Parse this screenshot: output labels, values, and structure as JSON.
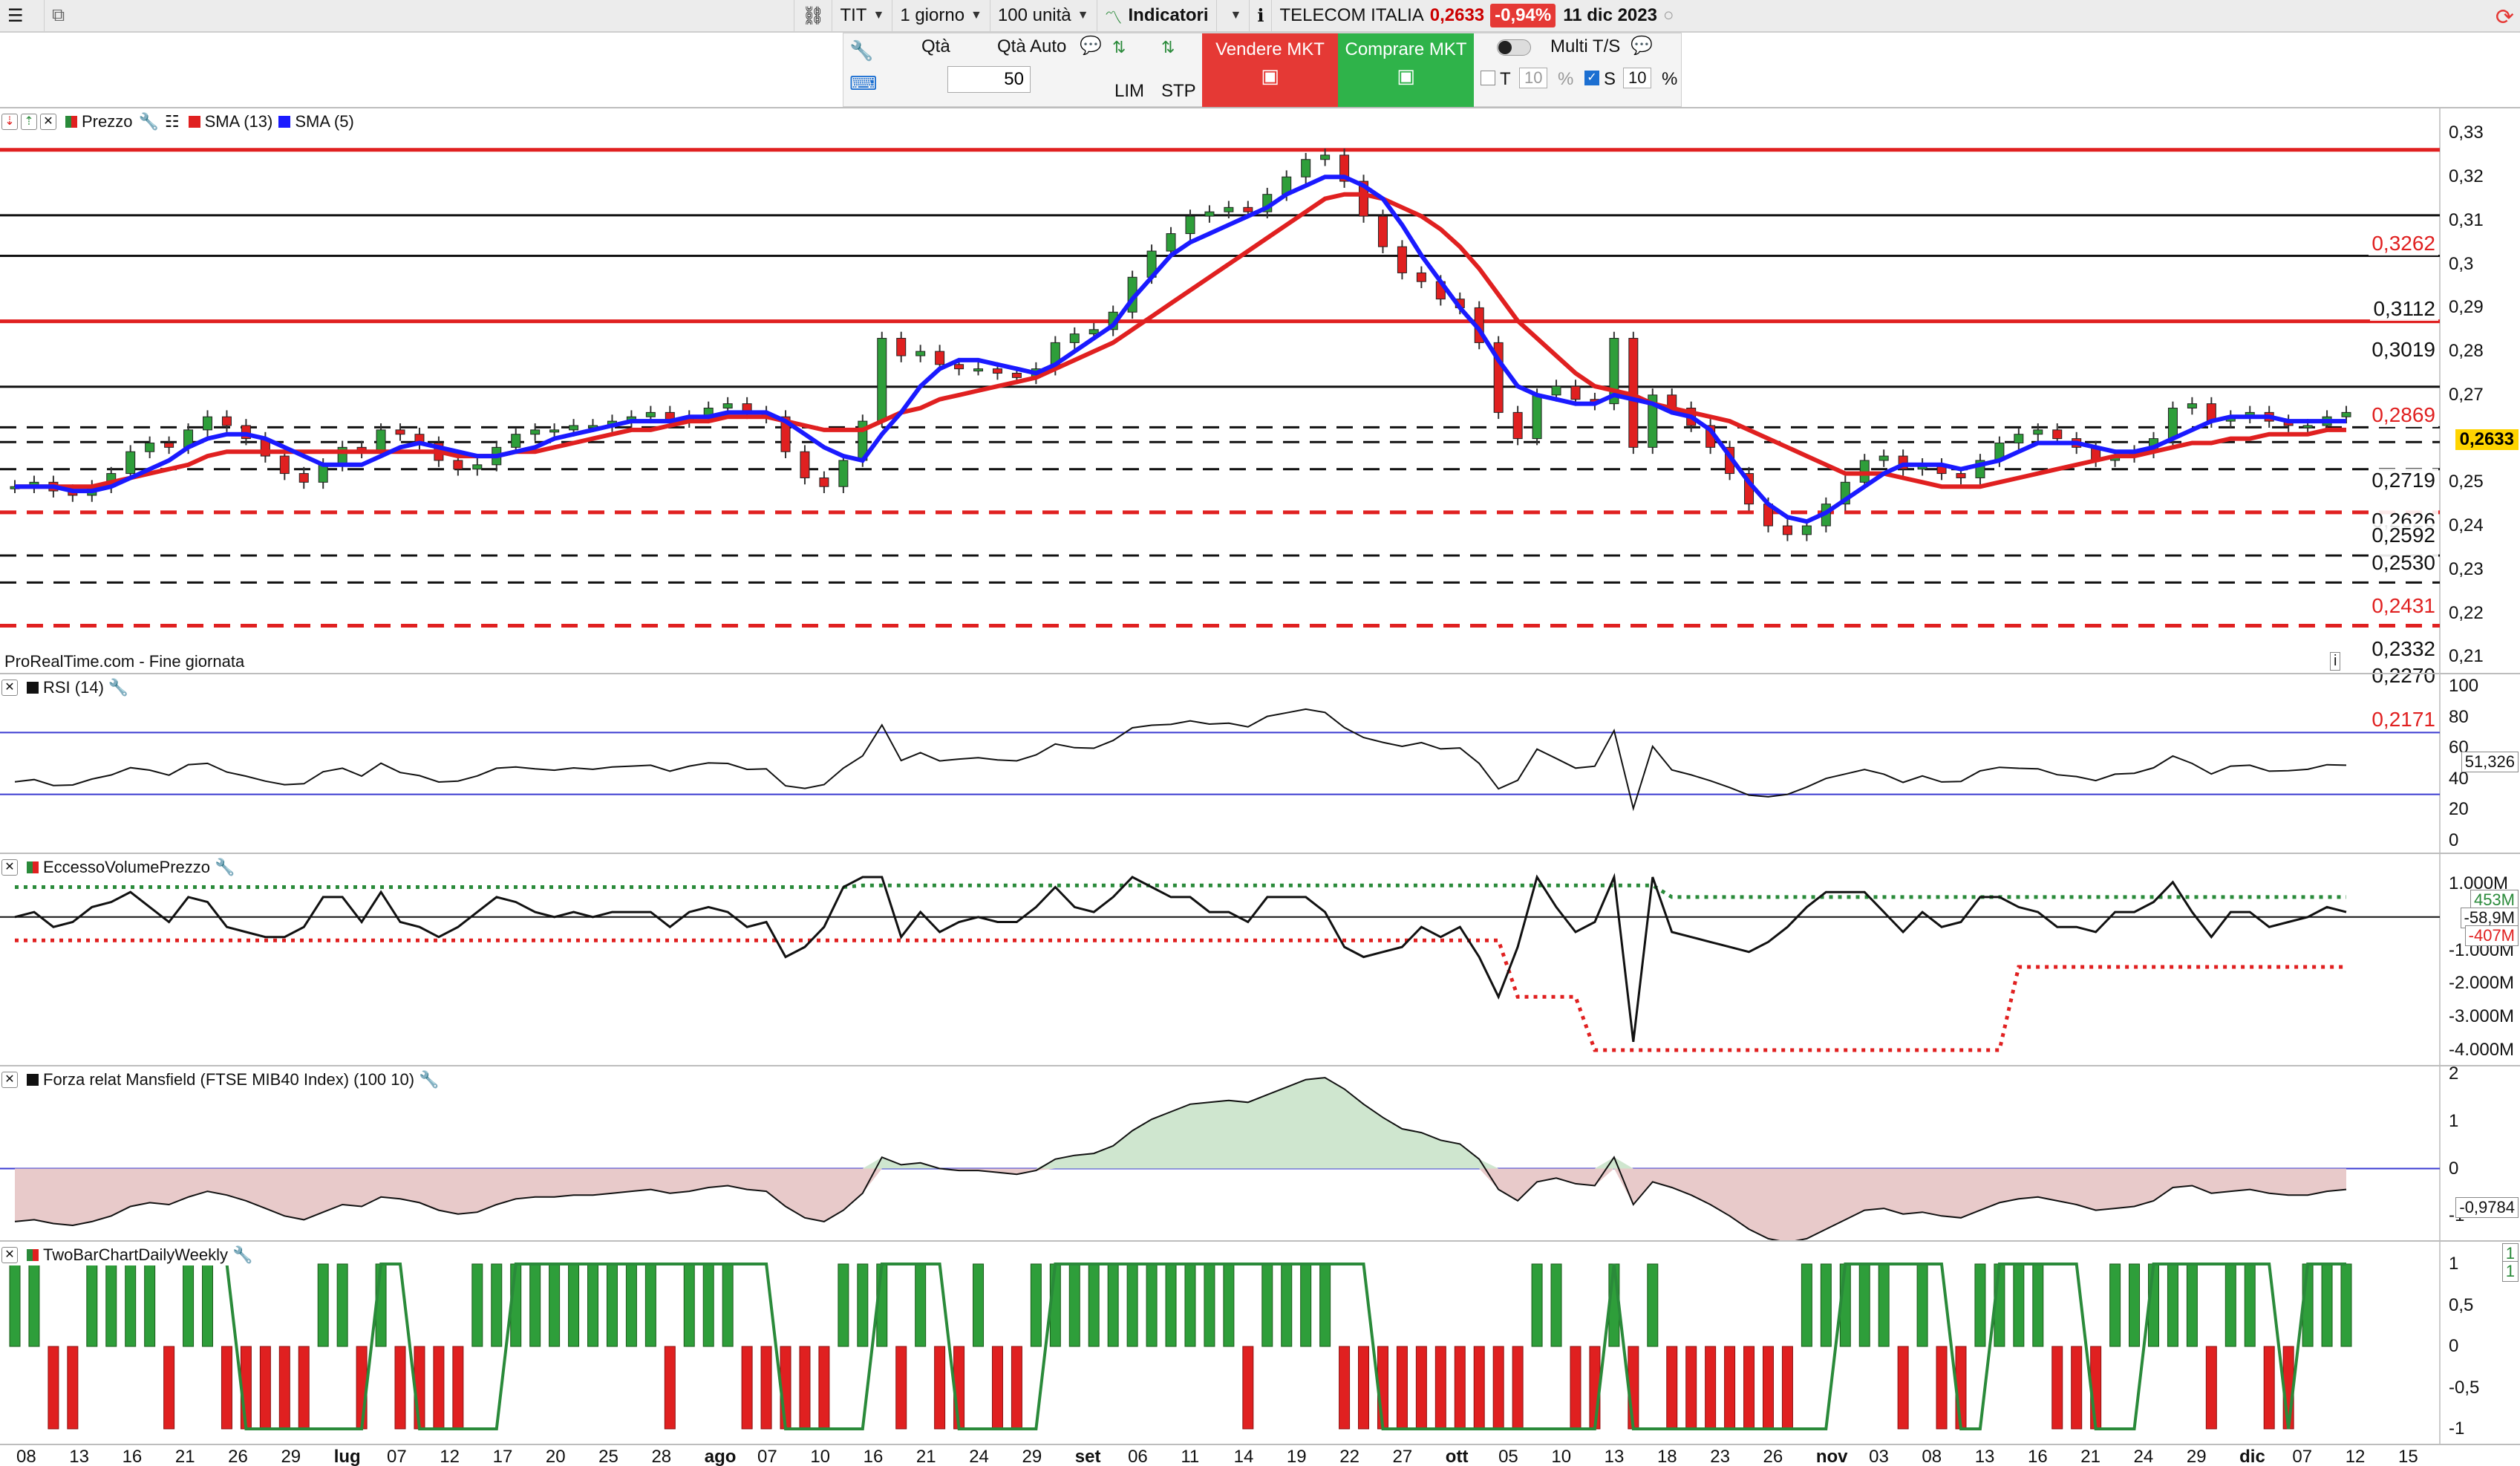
{
  "topbar": {
    "symbol": "TIT",
    "period": "1 giorno",
    "units": "100 unità",
    "indicators": "Indicatori",
    "instrument": "TELECOM ITALIA",
    "price": "0,2633",
    "change": "-0,94%",
    "date": "11 dic 2023"
  },
  "order": {
    "qty_label": "Qtà",
    "qty_auto_label": "Qtà Auto",
    "qty_value": "50",
    "lim_label": "LIM",
    "stp_label": "STP",
    "sell_label": "Vendere MKT",
    "buy_label": "Comprare MKT",
    "multi_ts_label": "Multi T/S",
    "t_label": "T",
    "t_value": "10",
    "s_label": "S",
    "s_value": "10",
    "pct": "%"
  },
  "price_panel": {
    "legend": {
      "price": "Prezzo",
      "sma13": "SMA (13)",
      "sma5": "SMA (5)"
    },
    "watermark": "ProRealTime.com - Fine giornata",
    "axis_ticks": [
      "0,33",
      "0,32",
      "0,31",
      "0,3",
      "0,29",
      "0,28",
      "0,27",
      "0,25",
      "0,24",
      "0,23",
      "0,22",
      "0,21"
    ],
    "levels": [
      {
        "label": "0,3262",
        "value": 0.3262,
        "color": "#e02020",
        "style": "solid"
      },
      {
        "label": "0,3112",
        "value": 0.3112,
        "color": "#111111",
        "style": "solid"
      },
      {
        "label": "0,3019",
        "value": 0.3019,
        "color": "#111111",
        "style": "solid"
      },
      {
        "label": "0,2869",
        "value": 0.2869,
        "color": "#e02020",
        "style": "solid"
      },
      {
        "label": "0,2719",
        "value": 0.2719,
        "color": "#111111",
        "style": "solid"
      },
      {
        "label": "0,2626",
        "value": 0.2626,
        "color": "#111111",
        "style": "dashed"
      },
      {
        "label": "0,2592",
        "value": 0.2592,
        "color": "#111111",
        "style": "dashed"
      },
      {
        "label": "0,2530",
        "value": 0.253,
        "color": "#111111",
        "style": "dashed"
      },
      {
        "label": "0,2431",
        "value": 0.2431,
        "color": "#e02020",
        "style": "dashed"
      },
      {
        "label": "0,2332",
        "value": 0.2332,
        "color": "#111111",
        "style": "dashed"
      },
      {
        "label": "0,2270",
        "value": 0.227,
        "color": "#111111",
        "style": "dashed"
      },
      {
        "label": "0,2171",
        "value": 0.2171,
        "color": "#e02020",
        "style": "dashed"
      }
    ],
    "last_price": "0,2633"
  },
  "rsi_panel": {
    "title": "RSI (14)",
    "ticks": [
      "100",
      "80",
      "60",
      "40",
      "20",
      "0"
    ],
    "value": "51,326"
  },
  "evp_panel": {
    "title": "EccessoVolumePrezzo",
    "ticks": [
      "1.000M",
      "-1.000M",
      "-2.000M",
      "-3.000M",
      "-4.000M"
    ],
    "upper": "453M",
    "mid": "-58,9M",
    "lower": "-407M"
  },
  "mansfield_panel": {
    "title": "Forza relat Mansfield (FTSE MIB40 Index) (100 10)",
    "ticks": [
      "2",
      "1",
      "0",
      "-1"
    ],
    "value": "-0,9784"
  },
  "twobar_panel": {
    "title": "TwoBarChartDailyWeekly",
    "ticks": [
      "1",
      "0,5",
      "0",
      "-0,5",
      "-1"
    ],
    "top_a": "1",
    "top_b": "1"
  },
  "dates": [
    "08",
    "13",
    "16",
    "21",
    "26",
    "29",
    "lug",
    "07",
    "12",
    "17",
    "20",
    "25",
    "28",
    "ago",
    "07",
    "10",
    "16",
    "21",
    "24",
    "29",
    "set",
    "06",
    "11",
    "14",
    "19",
    "22",
    "27",
    "ott",
    "05",
    "10",
    "13",
    "18",
    "23",
    "26",
    "nov",
    "03",
    "08",
    "13",
    "16",
    "21",
    "24",
    "29",
    "dic",
    "07",
    "12",
    "15"
  ],
  "chart_data": {
    "type": "candlestick",
    "title": "TELECOM ITALIA",
    "ylim": [
      0.208,
      0.334
    ],
    "close": [
      0.249,
      0.25,
      0.248,
      0.247,
      0.249,
      0.252,
      0.257,
      0.259,
      0.258,
      0.262,
      0.265,
      0.263,
      0.26,
      0.256,
      0.252,
      0.25,
      0.254,
      0.258,
      0.257,
      0.262,
      0.261,
      0.259,
      0.255,
      0.253,
      0.254,
      0.258,
      0.261,
      0.262,
      0.262,
      0.263,
      0.263,
      0.264,
      0.265,
      0.266,
      0.264,
      0.265,
      0.267,
      0.268,
      0.266,
      0.265,
      0.257,
      0.251,
      0.249,
      0.255,
      0.264,
      0.283,
      0.279,
      0.28,
      0.277,
      0.276,
      0.276,
      0.275,
      0.274,
      0.276,
      0.282,
      0.284,
      0.285,
      0.289,
      0.297,
      0.303,
      0.307,
      0.311,
      0.312,
      0.313,
      0.312,
      0.316,
      0.32,
      0.324,
      0.325,
      0.319,
      0.311,
      0.304,
      0.298,
      0.296,
      0.292,
      0.29,
      0.282,
      0.266,
      0.26,
      0.27,
      0.272,
      0.269,
      0.268,
      0.283,
      0.258,
      0.27,
      0.267,
      0.263,
      0.258,
      0.252,
      0.245,
      0.24,
      0.238,
      0.24,
      0.245,
      0.25,
      0.255,
      0.256,
      0.253,
      0.254,
      0.252,
      0.251,
      0.255,
      0.259,
      0.261,
      0.262,
      0.26,
      0.258,
      0.255,
      0.256,
      0.257,
      0.26,
      0.267,
      0.268,
      0.264,
      0.265,
      0.266,
      0.264,
      0.263,
      0.263,
      0.265,
      0.266
    ],
    "sma13": [
      0.249,
      0.249,
      0.249,
      0.249,
      0.249,
      0.25,
      0.251,
      0.252,
      0.253,
      0.254,
      0.256,
      0.257,
      0.257,
      0.257,
      0.257,
      0.257,
      0.257,
      0.257,
      0.257,
      0.257,
      0.257,
      0.257,
      0.257,
      0.256,
      0.256,
      0.256,
      0.257,
      0.257,
      0.258,
      0.259,
      0.26,
      0.261,
      0.262,
      0.262,
      0.263,
      0.264,
      0.264,
      0.265,
      0.265,
      0.265,
      0.264,
      0.263,
      0.262,
      0.262,
      0.262,
      0.264,
      0.266,
      0.267,
      0.269,
      0.27,
      0.271,
      0.272,
      0.273,
      0.274,
      0.276,
      0.278,
      0.28,
      0.282,
      0.285,
      0.288,
      0.291,
      0.294,
      0.297,
      0.3,
      0.303,
      0.306,
      0.309,
      0.312,
      0.315,
      0.316,
      0.316,
      0.315,
      0.313,
      0.311,
      0.308,
      0.304,
      0.299,
      0.293,
      0.287,
      0.283,
      0.279,
      0.275,
      0.272,
      0.271,
      0.27,
      0.268,
      0.267,
      0.266,
      0.265,
      0.264,
      0.262,
      0.26,
      0.258,
      0.256,
      0.254,
      0.252,
      0.252,
      0.252,
      0.251,
      0.25,
      0.249,
      0.249,
      0.249,
      0.25,
      0.251,
      0.252,
      0.253,
      0.254,
      0.255,
      0.256,
      0.256,
      0.257,
      0.258,
      0.259,
      0.259,
      0.26,
      0.26,
      0.261,
      0.261,
      0.261,
      0.262,
      0.262
    ],
    "sma5": [
      0.249,
      0.249,
      0.249,
      0.248,
      0.248,
      0.249,
      0.251,
      0.253,
      0.255,
      0.258,
      0.26,
      0.261,
      0.261,
      0.26,
      0.258,
      0.256,
      0.254,
      0.254,
      0.254,
      0.256,
      0.258,
      0.259,
      0.258,
      0.257,
      0.256,
      0.256,
      0.257,
      0.258,
      0.26,
      0.261,
      0.262,
      0.263,
      0.264,
      0.264,
      0.264,
      0.265,
      0.265,
      0.266,
      0.266,
      0.266,
      0.264,
      0.261,
      0.258,
      0.256,
      0.255,
      0.261,
      0.266,
      0.272,
      0.276,
      0.278,
      0.278,
      0.277,
      0.276,
      0.275,
      0.277,
      0.28,
      0.283,
      0.286,
      0.292,
      0.297,
      0.302,
      0.305,
      0.307,
      0.309,
      0.311,
      0.313,
      0.316,
      0.318,
      0.32,
      0.32,
      0.318,
      0.315,
      0.309,
      0.302,
      0.296,
      0.29,
      0.285,
      0.278,
      0.272,
      0.27,
      0.269,
      0.268,
      0.268,
      0.27,
      0.269,
      0.268,
      0.266,
      0.265,
      0.262,
      0.256,
      0.25,
      0.245,
      0.242,
      0.241,
      0.243,
      0.246,
      0.249,
      0.252,
      0.254,
      0.254,
      0.254,
      0.253,
      0.254,
      0.255,
      0.257,
      0.259,
      0.259,
      0.259,
      0.258,
      0.257,
      0.257,
      0.258,
      0.26,
      0.262,
      0.264,
      0.265,
      0.265,
      0.265,
      0.264,
      0.264,
      0.264,
      0.264
    ]
  }
}
